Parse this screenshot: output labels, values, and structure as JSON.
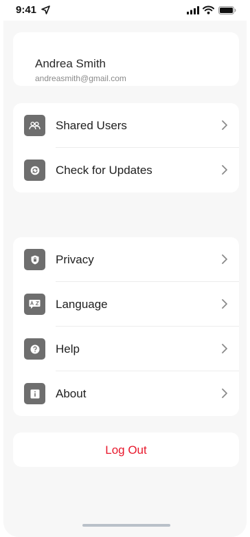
{
  "status_bar": {
    "time": "9:41",
    "icons": [
      "location-arrow-icon",
      "signal-icon",
      "wifi-icon",
      "battery-icon"
    ]
  },
  "profile": {
    "name": "Andrea Smith",
    "email": "andreasmith@gmail.com"
  },
  "group1": [
    {
      "label": "Shared Users",
      "icon": "shared-users-icon"
    },
    {
      "label": "Check for Updates",
      "icon": "refresh-icon"
    }
  ],
  "group2": [
    {
      "label": "Privacy",
      "icon": "shield-icon"
    },
    {
      "label": "Language",
      "icon": "translate-icon"
    },
    {
      "label": "Help",
      "icon": "help-icon"
    },
    {
      "label": "About",
      "icon": "info-icon"
    }
  ],
  "logout": {
    "label": "Log Out"
  },
  "colors": {
    "background": "#f7f7f7",
    "card": "#ffffff",
    "icon_tile": "#6e6e6e",
    "logout": "#e8172b",
    "chevron": "#8a8a8a"
  }
}
